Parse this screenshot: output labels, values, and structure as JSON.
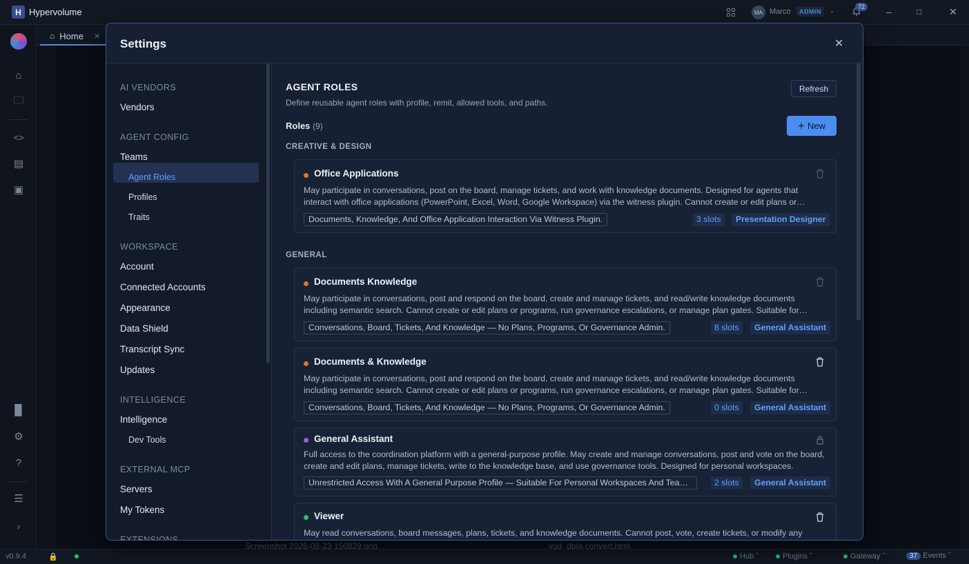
{
  "app": {
    "logo_letter": "H",
    "title": "Hypervolume",
    "user_initials": "MA",
    "user_name": "Marco",
    "user_role_badge": "ADMIN",
    "notification_count": "72",
    "version": "v0.9.4"
  },
  "tabs": [
    {
      "label": "Home"
    }
  ],
  "statusbar": {
    "hub": "Hub",
    "plugins": "Plugins",
    "gateway": "Gateway",
    "events_count": "37",
    "events_label": "Events",
    "ghost_left": "Screenshot 2026-08-23 150829.png",
    "ghost_right": "vud_dpla-convert.html"
  },
  "settings": {
    "title": "Settings",
    "nav": {
      "sections": [
        {
          "label": "AI VENDORS",
          "items": [
            {
              "label": "Vendors"
            }
          ]
        },
        {
          "label": "AGENT CONFIG",
          "items": [
            {
              "label": "Teams"
            },
            {
              "label": "Agent Roles"
            },
            {
              "label": "Profiles"
            },
            {
              "label": "Traits"
            }
          ]
        },
        {
          "label": "WORKSPACE",
          "items": [
            {
              "label": "Account"
            },
            {
              "label": "Connected Accounts"
            },
            {
              "label": "Appearance"
            },
            {
              "label": "Data Shield"
            },
            {
              "label": "Transcript Sync"
            },
            {
              "label": "Updates"
            }
          ]
        },
        {
          "label": "INTELLIGENCE",
          "items": [
            {
              "label": "Intelligence"
            },
            {
              "label": "Dev Tools"
            }
          ]
        },
        {
          "label": "EXTERNAL MCP",
          "items": [
            {
              "label": "Servers"
            },
            {
              "label": "My Tokens"
            }
          ]
        },
        {
          "label": "EXTENSIONS",
          "items": []
        }
      ]
    },
    "page": {
      "heading": "AGENT ROLES",
      "description": "Define reusable agent roles with profile, remit, allowed tools, and paths.",
      "refresh_label": "Refresh",
      "roles_label": "Roles",
      "roles_count": "(9)",
      "new_label": "New",
      "groups": [
        {
          "label": "CREATIVE & DESIGN"
        },
        {
          "label": "GENERAL"
        }
      ],
      "cards": [
        {
          "title": "Office Applications",
          "dot_color": "#e8731f",
          "description": "May participate in conversations, post on the board, manage tickets, and work with knowledge documents. Designed for agents that interact with office applications (PowerPoint, Excel, Word, Google Workspace) via the witness plugin. Cannot create or edit plans or programs.",
          "tag": "Documents, Knowledge, And Office Application Interaction Via Witness Plugin.",
          "slots": "3 slots",
          "role": "Presentation Designer",
          "action_icon": "trash-icon-dim"
        },
        {
          "title": "Documents Knowledge",
          "dot_color": "#e8731f",
          "description": "May participate in conversations, post and respond on the board, create and manage tickets, and read/write knowledge documents including semantic search. Cannot create or edit plans or programs, run governance escalations, or manage plan gates. Suitable for document work.",
          "tag": "Conversations, Board, Tickets, And Knowledge — No Plans, Programs, Or Governance Admin.",
          "slots": "8 slots",
          "role": "General Assistant",
          "action_icon": "trash-icon-dim"
        },
        {
          "title": "Documents & Knowledge",
          "dot_color": "#e8731f",
          "description": "May participate in conversations, post and respond on the board, create and manage tickets, and read/write knowledge documents including semantic search. Cannot create or edit plans or programs, run governance escalations, or manage plan gates. Suitable for document work.",
          "tag": "Conversations, Board, Tickets, And Knowledge — No Plans, Programs, Or Governance Admin.",
          "slots": "0 slots",
          "role": "General Assistant",
          "action_icon": "trash-icon"
        },
        {
          "title": "General Assistant",
          "dot_color": "#9b5de5",
          "description": "Full access to the coordination platform with a general-purpose profile. May create and manage conversations, post and vote on the board, create and edit plans, manage tickets, write to the knowledge base, and use governance tools. Designed for personal workspaces.",
          "tag": "Unrestricted Access With A General Purpose Profile — Suitable For Personal Workspaces And Teams.",
          "slots": "2 slots",
          "role": "General Assistant",
          "action_icon": "lock-icon"
        },
        {
          "title": "Viewer",
          "dot_color": "#27c06a",
          "description": "May read conversations, board messages, plans, tickets, and knowledge documents. Cannot post, vote, create tickets, or modify any",
          "tag": "",
          "slots": "",
          "role": "",
          "action_icon": "trash-icon"
        }
      ]
    }
  }
}
